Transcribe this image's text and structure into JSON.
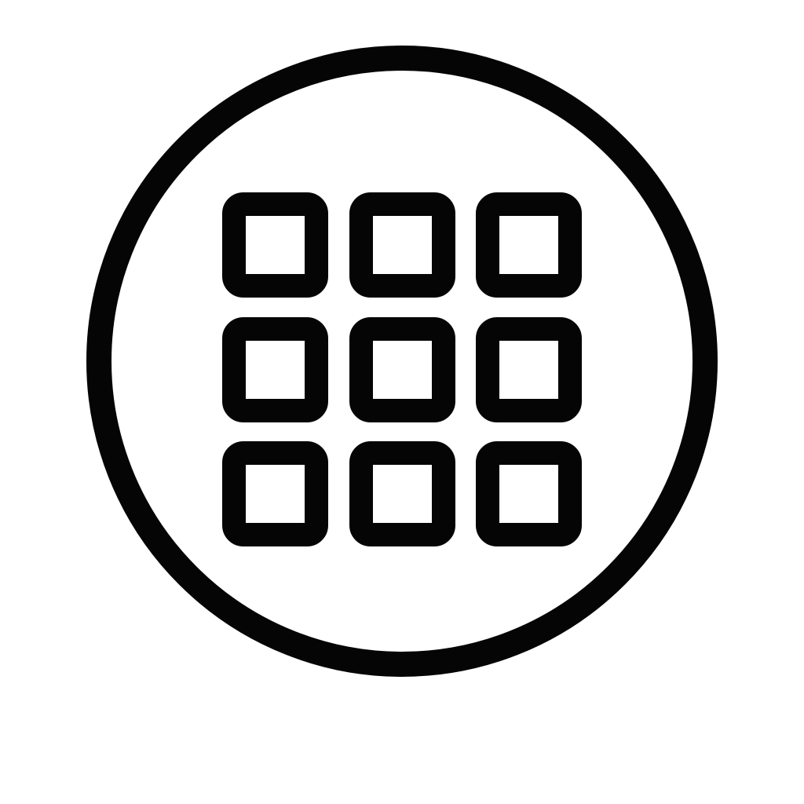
{
  "icon": {
    "name": "app-grid-in-circle-icon",
    "stroke_color": "#050505",
    "background_color": "#ffffff",
    "grid": {
      "rows": 3,
      "columns": 3
    }
  }
}
